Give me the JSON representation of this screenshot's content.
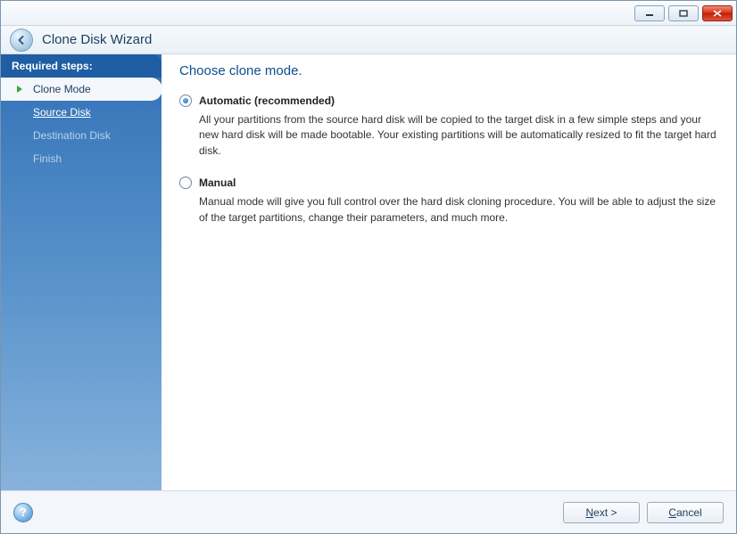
{
  "window": {
    "title": "Clone Disk Wizard"
  },
  "sidebar": {
    "header": "Required steps:",
    "steps": [
      {
        "label": "Clone Mode",
        "state": "active"
      },
      {
        "label": "Source Disk",
        "state": "link"
      },
      {
        "label": "Destination Disk",
        "state": "muted"
      },
      {
        "label": "Finish",
        "state": "muted"
      }
    ]
  },
  "main": {
    "title": "Choose clone mode.",
    "options": [
      {
        "key": "automatic",
        "label": "Automatic (recommended)",
        "selected": true,
        "description": "All your partitions from the source hard disk will be copied to the target disk in a few simple steps and your new hard disk will be made bootable. Your existing partitions will be automatically resized to fit the target hard disk."
      },
      {
        "key": "manual",
        "label": "Manual",
        "selected": false,
        "description": "Manual mode will give you full control over the hard disk cloning procedure. You will be able to adjust the size of the target partitions, change their parameters, and much more."
      }
    ]
  },
  "footer": {
    "help_tooltip": "Help",
    "next_label": "Next >",
    "next_accelerator": "N",
    "cancel_label": "Cancel",
    "cancel_accelerator": "C"
  }
}
